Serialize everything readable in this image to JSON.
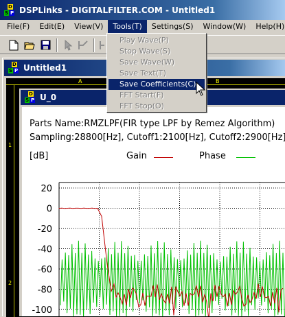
{
  "app": {
    "title": "DSPLinks - DIGITALFILTER.COM - Untitled1",
    "icon": "dsp-icon",
    "icon_letters": [
      "D",
      "S",
      "P"
    ]
  },
  "menubar": [
    "File(F)",
    "Edit(E)",
    "View(V)",
    "Tools(T)",
    "Settings(S)",
    "Window(W)",
    "Help(H)"
  ],
  "tools_menu": {
    "items": [
      "Play Wave(P)",
      "Stop Wave(S)",
      "Save Wave(W)",
      "Save Text(T)",
      "Save Coefficients(C)",
      "FFT Start(F)",
      "FFT Stop(O)"
    ],
    "highlighted": "Save Coefficients(C)"
  },
  "toolbar": {
    "buttons": [
      "new-file-icon",
      "open-folder-icon",
      "save-disk-icon",
      "pointer-icon",
      "wire-tool-icon",
      "fit-tool-icon"
    ]
  },
  "mdi_window": {
    "title": "Untitled1",
    "ruler_labels": [
      "A",
      "B",
      "1",
      "2"
    ]
  },
  "graph_window": {
    "title": "U_0",
    "parts_name": "Parts Name:RMZLPF(FIR type LPF by Remez Algorithm)",
    "sampling": "Sampling:28800[Hz], Cutoff1:2100[Hz], Cutoff2:2900[Hz]",
    "unit": "[dB]",
    "legend": {
      "gain": "Gain",
      "phase": "Phase",
      "gain_color": "#c00000",
      "phase_color": "#00c000"
    }
  },
  "chart_data": {
    "type": "line",
    "ylabel": "[dB]",
    "y_ticks": [
      20,
      0,
      -20,
      -40,
      -60,
      -80,
      -100
    ],
    "ylim": [
      -110,
      20
    ],
    "series": [
      {
        "name": "Gain",
        "color": "#c00000"
      },
      {
        "name": "Phase",
        "color": "#00c000"
      }
    ]
  }
}
